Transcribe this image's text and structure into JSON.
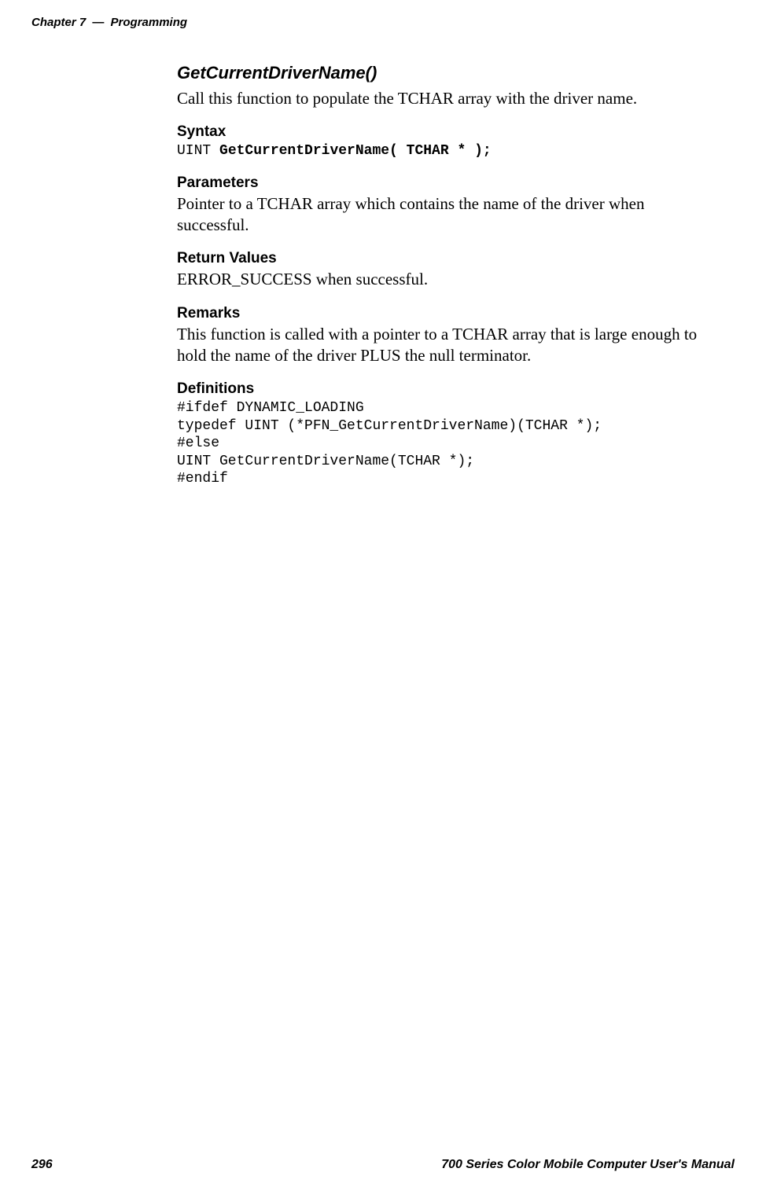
{
  "header": {
    "chapter": "Chapter 7",
    "dash": "—",
    "title": "Programming"
  },
  "func_title": "GetCurrentDriverName()",
  "intro_text": "Call this function to populate the TCHAR array with the driver name.",
  "syntax": {
    "heading": "Syntax",
    "code_prefix": "UINT ",
    "code_bold": "GetCurrentDriverName( TCHAR * );"
  },
  "parameters": {
    "heading": "Parameters",
    "text": "Pointer to a TCHAR array which contains the name of the driver when successful."
  },
  "return_values": {
    "heading": "Return Values",
    "text": "ERROR_SUCCESS when successful."
  },
  "remarks": {
    "heading": "Remarks",
    "text": "This function is called with a pointer to a TCHAR array that is large enough to hold the name of the driver PLUS the null terminator."
  },
  "definitions": {
    "heading": "Definitions",
    "code": "#ifdef DYNAMIC_LOADING\ntypedef UINT (*PFN_GetCurrentDriverName)(TCHAR *);\n#else\nUINT GetCurrentDriverName(TCHAR *);\n#endif"
  },
  "footer": {
    "page_number": "296",
    "manual_title": "700 Series Color Mobile Computer User's Manual"
  }
}
